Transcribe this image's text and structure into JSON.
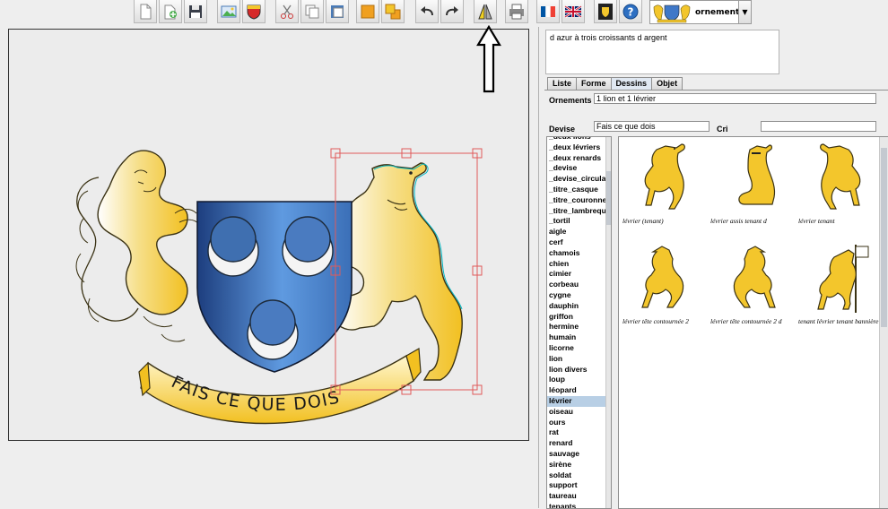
{
  "toolbar": {
    "ornament_combo_label": "ornements",
    "buttons": [
      "new",
      "open",
      "save",
      "export-image",
      "shield",
      "cut",
      "copy",
      "paste",
      "bring-front",
      "send-back",
      "undo",
      "redo",
      "symmetry",
      "print",
      "french-flag",
      "uk-flag",
      "heraldry-book",
      "help"
    ]
  },
  "canvas": {
    "motto": "FAIS CE QUE DOIS"
  },
  "description": "d azur à trois croissants d argent",
  "tabs": [
    "Liste",
    "Forme",
    "Dessins",
    "Objet"
  ],
  "active_tab": "Dessins",
  "ornaments": {
    "label": "Ornements",
    "value": "1 lion et 1 lévrier"
  },
  "devise": {
    "label": "Devise",
    "value": "Fais ce que dois"
  },
  "cri": {
    "label": "Cri",
    "value": ""
  },
  "category_list": [
    "_deux lions",
    "_deux lévriers",
    "_deux renards",
    "_devise",
    "_devise_circulaire",
    "_titre_casque",
    "_titre_couronne",
    "_titre_lambrequin",
    "_tortil",
    "aigle",
    "cerf",
    "chamois",
    "chien",
    "cimier",
    "corbeau",
    "cygne",
    "dauphin",
    "griffon",
    "hermine",
    "humain",
    "licorne",
    "lion",
    "lion divers",
    "loup",
    "léopard",
    "lévrier",
    "oiseau",
    "ours",
    "rat",
    "renard",
    "sauvage",
    "sirène",
    "soldat",
    "support",
    "taureau",
    "tenants"
  ],
  "selected_category": "lévrier",
  "gallery": [
    {
      "caption": "lévrier (tenant)"
    },
    {
      "caption": "lévrier assis tenant d"
    },
    {
      "caption": "lévrier tenant"
    },
    {
      "caption": "lévrier tête contournée 2"
    },
    {
      "caption": "lévrier tête contournée 2 d"
    },
    {
      "caption": "tenant lévrier tenant bannière"
    }
  ],
  "colors": {
    "shield_blue": "#3f78c8",
    "gold": "#f3c62c",
    "selection_red": "#e05a5a",
    "list_selection": "#b8cfe5"
  }
}
